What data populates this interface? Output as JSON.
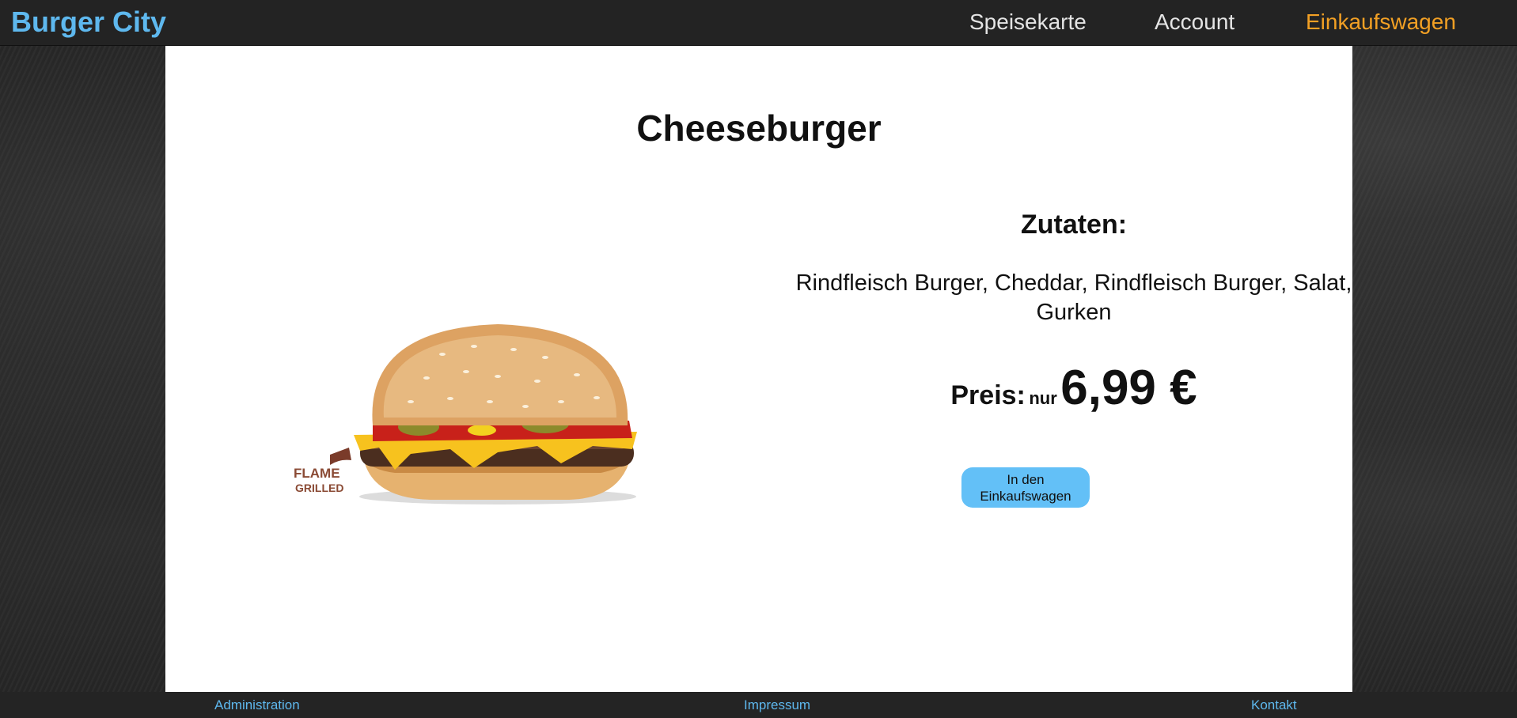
{
  "header": {
    "brand": "Burger City",
    "nav": {
      "menu": "Speisekarte",
      "account": "Account",
      "cart": "Einkaufswagen"
    },
    "colors": {
      "brand": "#5eb8ee",
      "active_nav": "#f2a024",
      "nav": "#e4e4e4"
    }
  },
  "product": {
    "name": "Cheeseburger",
    "ingredients_heading": "Zutaten:",
    "ingredients": "Rindfleisch Burger, Cheddar, Rindfleisch Burger, Salat, Gurken",
    "price_label": "Preis:",
    "price_prefix": "nur",
    "price": "6,99 €",
    "add_to_cart": "In den Einkaufswagen",
    "image_badge": "FLAME GRILLED",
    "image_alt": "burger-image"
  },
  "footer": {
    "administration": "Administration",
    "imprint": "Impressum",
    "contact": "Kontakt"
  }
}
